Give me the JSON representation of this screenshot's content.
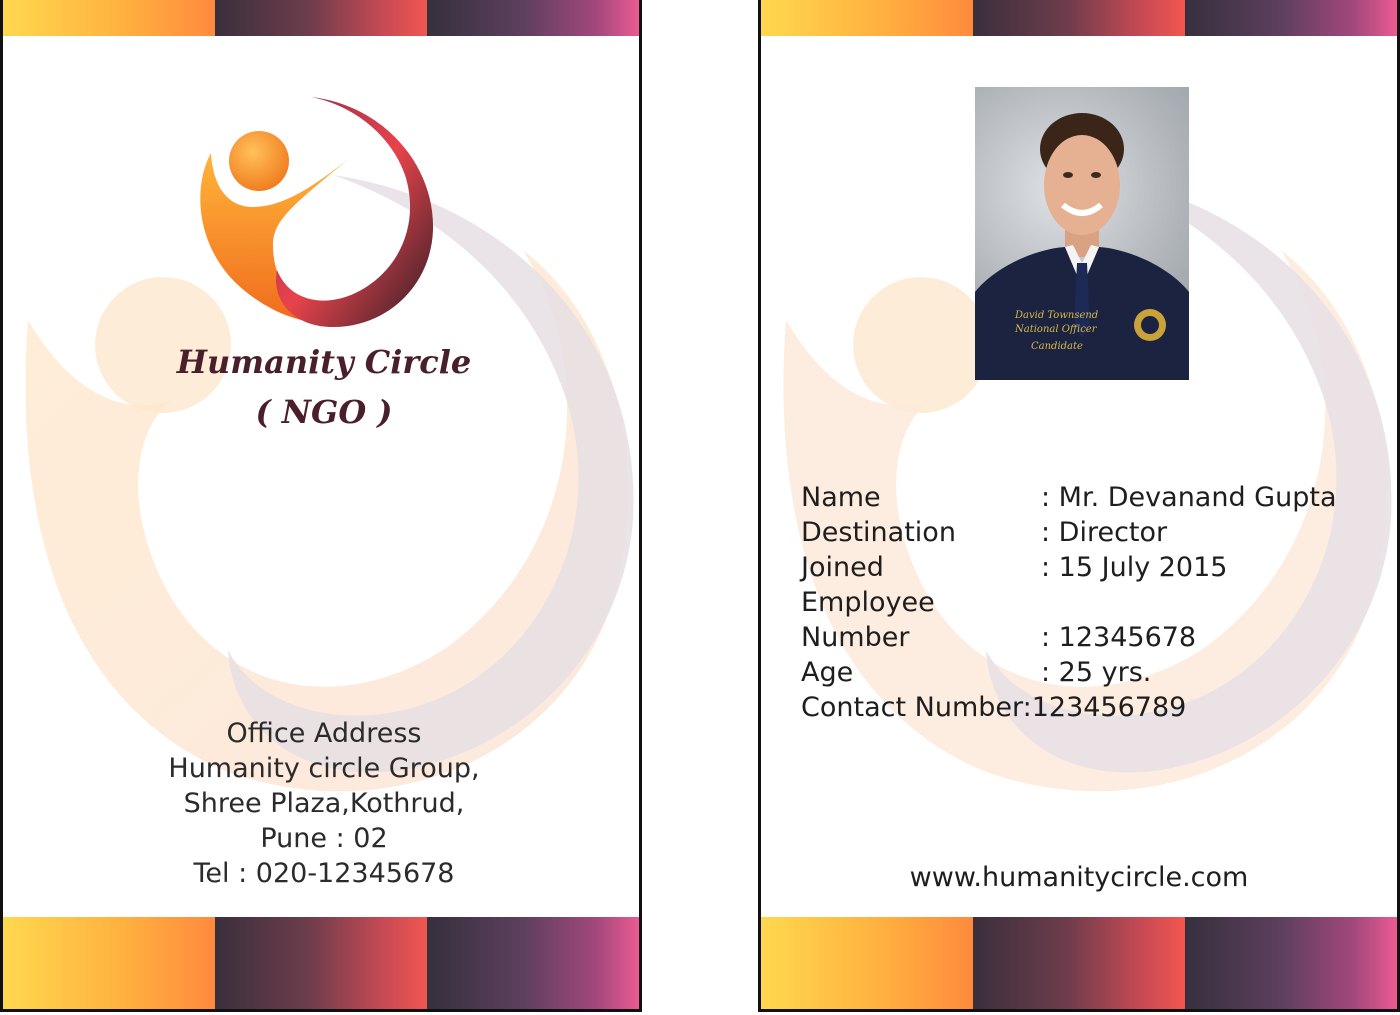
{
  "front": {
    "org_name": "Humanity Circle",
    "org_sub": "( NGO )",
    "address_title": "Office Address",
    "address_lines": [
      "Humanity circle Group,",
      "Shree Plaza,Kothrud,",
      "Pune : 02",
      "Tel : 020-12345678"
    ]
  },
  "back": {
    "fields": [
      {
        "label": "Name",
        "value": ": Mr. Devanand Gupta"
      },
      {
        "label": "Destination",
        "value": ": Director"
      },
      {
        "label": "Joined",
        "value": ": 15 July 2015"
      },
      {
        "label": "Employee",
        "value": ""
      },
      {
        "label": "Number",
        "value": ": 12345678"
      },
      {
        "label": "Age",
        "value": ": 25 yrs."
      },
      {
        "label": "Contact Number:",
        "value": " 123456789"
      }
    ],
    "website": "www.humanitycircle.com",
    "photo_jacket_text": [
      "David Townsend",
      "National Officer",
      "Candidate"
    ]
  },
  "colors": {
    "brand_orange": "#ff9a2e",
    "brand_maroon": "#4a1f2c",
    "brand_red": "#e8434c",
    "brand_pink": "#ea5b92"
  }
}
